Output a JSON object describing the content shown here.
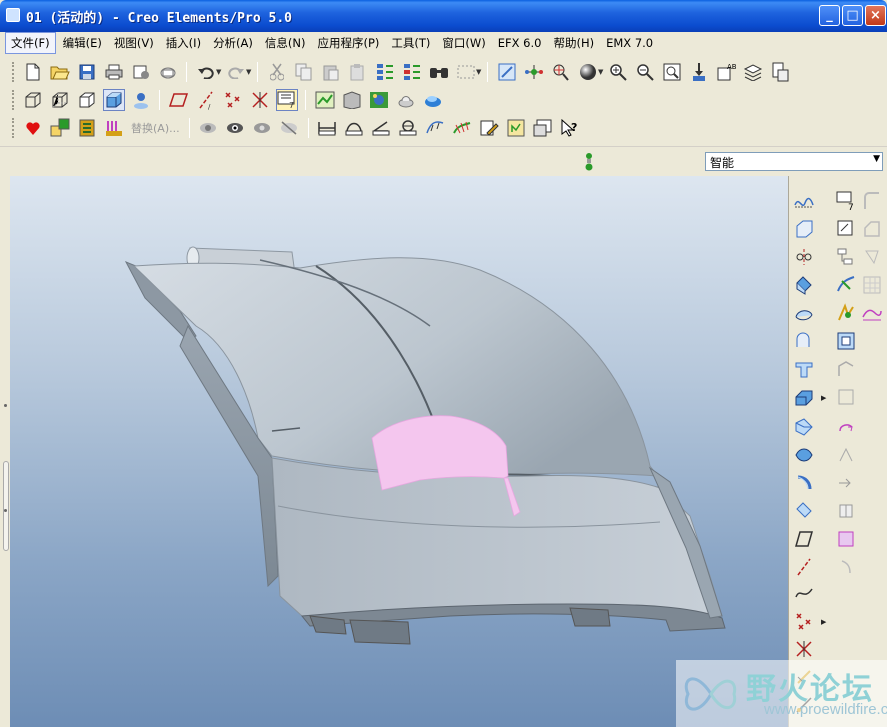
{
  "window": {
    "title": "01 (活动的) - Creo Elements/Pro 5.0",
    "minimize": "_",
    "maximize": "□",
    "close": "×"
  },
  "menu": {
    "items": [
      {
        "label": "文件(F)"
      },
      {
        "label": "编辑(E)"
      },
      {
        "label": "视图(V)"
      },
      {
        "label": "插入(I)"
      },
      {
        "label": "分析(A)"
      },
      {
        "label": "信息(N)"
      },
      {
        "label": "应用程序(P)"
      },
      {
        "label": "工具(T)"
      },
      {
        "label": "窗口(W)"
      },
      {
        "label": "EFX 6.0"
      },
      {
        "label": "帮助(H)"
      },
      {
        "label": "EMX 7.0"
      }
    ]
  },
  "toolbar3": {
    "replace_label": "替换(A)..."
  },
  "filter": {
    "selected": "智能",
    "arrow": "▼"
  },
  "icons": {
    "row1": [
      "new-icon",
      "open-icon",
      "save-icon",
      "print-icon",
      "send-icon",
      "mail-icon",
      "undo-icon",
      "redo-icon",
      "cut-icon",
      "copy-icon",
      "paste-icon",
      "paste-special-icon",
      "regenerate-icon",
      "regen-manager-icon",
      "find-icon",
      "select-box-icon",
      "repaint-icon",
      "spin-center-icon",
      "orient-mode-icon",
      "appearance-icon",
      "zoom-in-icon",
      "zoom-out-icon",
      "refit-icon",
      "reorient-icon",
      "saved-views-icon",
      "layers-icon",
      "view-manager-icon"
    ],
    "row2": [
      "wireframe-icon",
      "hidden-line-icon",
      "no-hidden-icon",
      "shading-icon",
      "enhanced-realism-icon",
      "datum-planes-icon",
      "datum-axes-icon",
      "datum-points-icon",
      "coordinate-systems-icon",
      "annotations-icon",
      "model-tree-icon",
      "render-icon",
      "scene-icon",
      "lights-icon",
      "room-icon"
    ],
    "row3": [
      "favorite-icon",
      "family-table-icon",
      "relations-icon",
      "parameters-icon",
      "hide-icon",
      "show-icon",
      "eye-icon",
      "unhide-icon",
      "distance-icon",
      "length-icon",
      "angle-icon",
      "area-icon",
      "curve-analysis-icon",
      "surface-analysis-icon",
      "edit-icon",
      "table-icon",
      "notes-icon",
      "whats-this-icon"
    ]
  },
  "colors": {
    "titlebar": "#0b4ccf",
    "canvas_top": "#dde6f0",
    "canvas_bottom": "#6d8db5",
    "model_surface": "#c4ccd4",
    "highlight": "#f4c6ee"
  },
  "watermark": {
    "text": "野火论坛",
    "url": "www.proewildfire.cn"
  }
}
